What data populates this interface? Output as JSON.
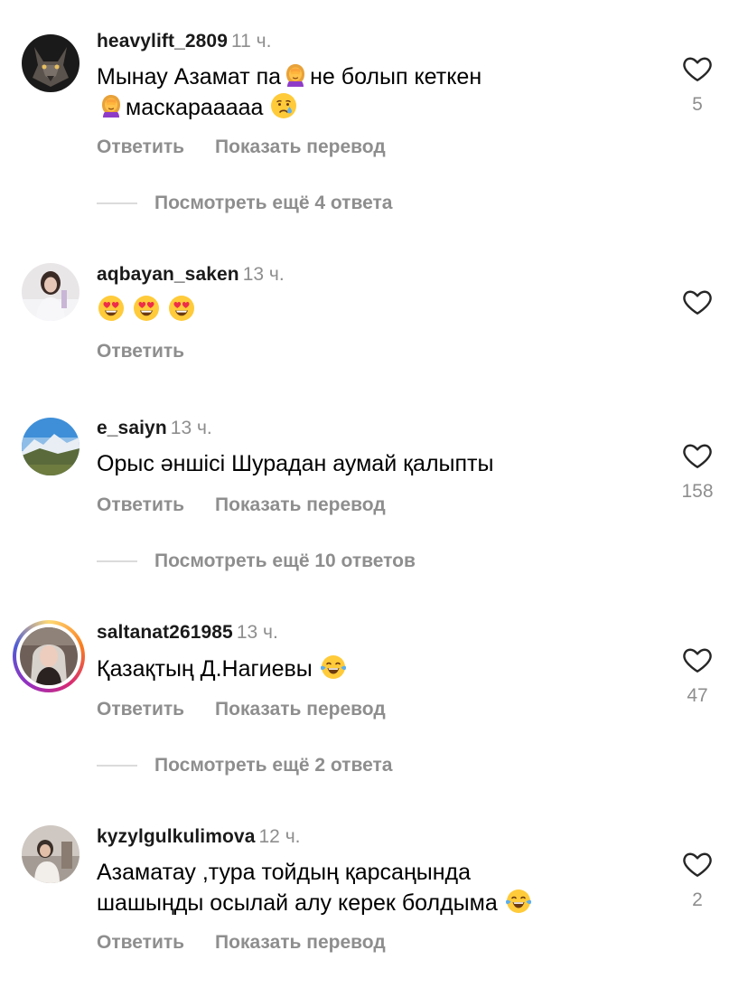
{
  "actions": {
    "reply_label": "Ответить",
    "translate_label": "Показать перевод"
  },
  "colors": {
    "secondary_text": "#8e8e8e",
    "divider": "#dbdbdb",
    "story_ring": [
      "#feda75",
      "#fa7e1e",
      "#d62976",
      "#962fbf",
      "#4f5bd5"
    ]
  },
  "comments": [
    {
      "username": "heavylift_2809",
      "time": "11 ч.",
      "text_parts": [
        "Мынау Азамат па",
        "не болып кеткен",
        "маскарааааа"
      ],
      "emojis": [
        "woman-facepalming",
        "woman-facepalming",
        "crying-face"
      ],
      "likes": "5",
      "view_replies": "Посмотреть ещё 4 ответа"
    },
    {
      "username": "aqbayan_saken",
      "time": "13 ч.",
      "emojis": [
        "heart-eyes-face",
        "heart-eyes-face",
        "heart-eyes-face"
      ],
      "likes": ""
    },
    {
      "username": "e_saiyn",
      "time": "13 ч.",
      "text": "Орыс әншісі Шурадан аумай қалыпты",
      "likes": "158",
      "view_replies": "Посмотреть ещё 10 ответов"
    },
    {
      "username": "saltanat261985",
      "time": "13 ч.",
      "text": "Қазақтың Д.Нагиевы",
      "emojis": [
        "tears-of-joy-face"
      ],
      "likes": "47",
      "view_replies": "Посмотреть ещё 2 ответа",
      "has_story_ring": true
    },
    {
      "username": "kyzylgulkulimova",
      "time": "12 ч.",
      "text_line1": "Азаматау ,тура тойдың қарсаңында",
      "text_line2": "шашыңды осылай алу керек болдыма",
      "emojis": [
        "tears-of-joy-face"
      ],
      "likes": "2"
    }
  ]
}
